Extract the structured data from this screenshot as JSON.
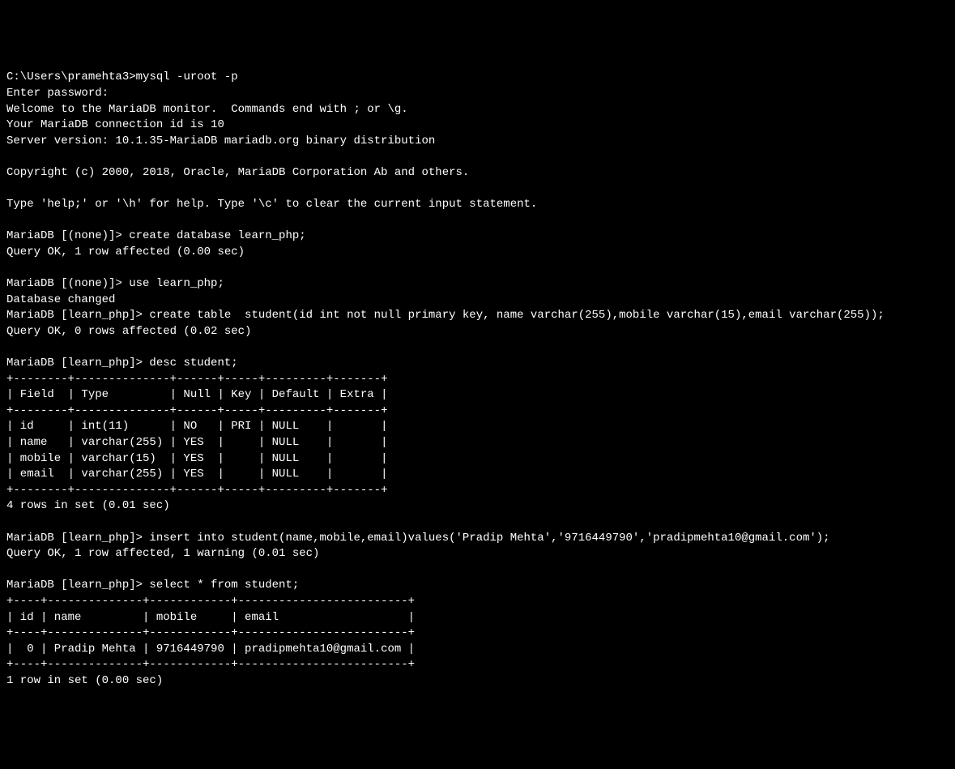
{
  "prompt_path": "C:\\Users\\pramehta3>",
  "command1": "mysql -uroot -p",
  "line_enter_password": "Enter password:",
  "line_welcome": "Welcome to the MariaDB monitor.  Commands end with ; or \\g.",
  "line_connection_id": "Your MariaDB connection id is 10",
  "line_server_version": "Server version: 10.1.35-MariaDB mariadb.org binary distribution",
  "line_copyright": "Copyright (c) 2000, 2018, Oracle, MariaDB Corporation Ab and others.",
  "line_help": "Type 'help;' or '\\h' for help. Type '\\c' to clear the current input statement.",
  "prompt_none": "MariaDB [(none)]>",
  "prompt_learn": "MariaDB [learn_php]>",
  "cmd_create_db": " create database learn_php;",
  "result_create_db": "Query OK, 1 row affected (0.00 sec)",
  "cmd_use_db": " use learn_php;",
  "result_db_changed": "Database changed",
  "cmd_create_table": " create table  student(id int not null primary key, name varchar(255),mobile varchar(15),email varchar(255));",
  "result_create_table": "Query OK, 0 rows affected (0.02 sec)",
  "cmd_desc": " desc student;",
  "desc_border": "+--------+--------------+------+-----+---------+-------+",
  "desc_header": "| Field  | Type         | Null | Key | Default | Extra |",
  "desc_row1": "| id     | int(11)      | NO   | PRI | NULL    |       |",
  "desc_row2": "| name   | varchar(255) | YES  |     | NULL    |       |",
  "desc_row3": "| mobile | varchar(15)  | YES  |     | NULL    |       |",
  "desc_row4": "| email  | varchar(255) | YES  |     | NULL    |       |",
  "desc_result": "4 rows in set (0.01 sec)",
  "cmd_insert": " insert into student(name,mobile,email)values('Pradip Mehta','9716449790','pradipmehta10@gmail.com');",
  "result_insert": "Query OK, 1 row affected, 1 warning (0.01 sec)",
  "cmd_select": " select * from student;",
  "select_border": "+----+--------------+------------+-------------------------+",
  "select_header": "| id | name         | mobile     | email                   |",
  "select_row1": "|  0 | Pradip Mehta | 9716449790 | pradipmehta10@gmail.com |",
  "select_result": "1 row in set (0.00 sec)"
}
